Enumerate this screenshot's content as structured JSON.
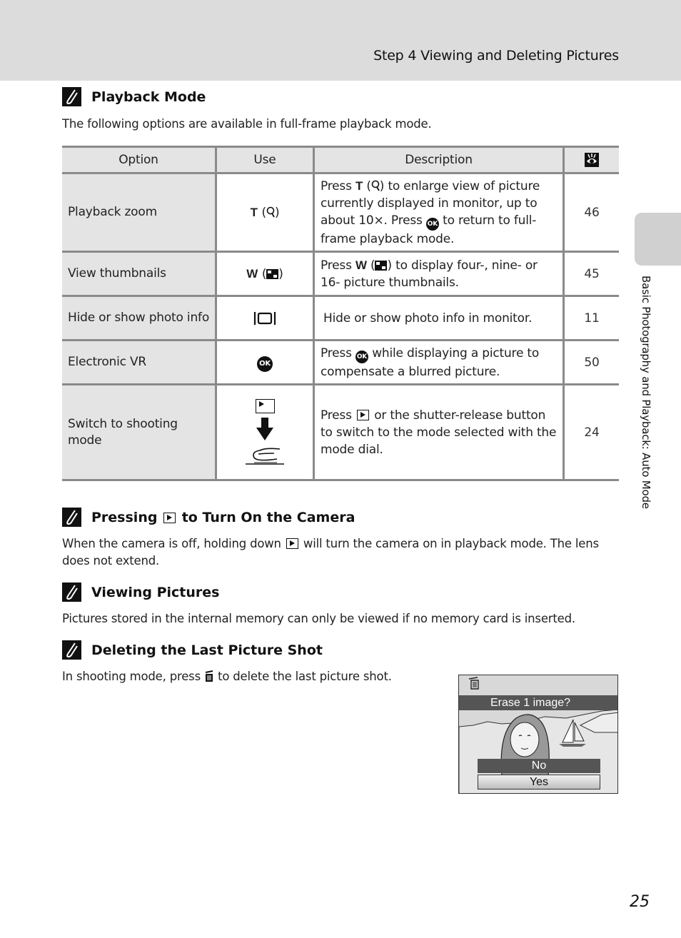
{
  "header": {
    "title": "Step 4 Viewing and Deleting Pictures"
  },
  "side_tab": {
    "label": "Basic Photography and Playback: Auto Mode"
  },
  "page_number": "25",
  "sections": {
    "playback_mode": {
      "title": "Playback Mode",
      "body": "The following options are available in full-frame playback mode."
    },
    "pressing_play": {
      "title_before": "Pressing",
      "title_after": "to Turn On the Camera",
      "body_before": "When the camera is off, holding down",
      "body_after": "will turn the camera on in playback mode. The lens does not extend."
    },
    "viewing_pictures": {
      "title": "Viewing Pictures",
      "body": "Pictures stored in the internal memory can only be viewed if no memory card is inserted."
    },
    "deleting_last": {
      "title": "Deleting the Last Picture Shot",
      "body_before": "In shooting mode, press",
      "body_after": "to delete the last picture shot."
    }
  },
  "table": {
    "headers": {
      "option": "Option",
      "use": "Use",
      "description": "Description",
      "page_icon": "reference-eye-icon"
    },
    "rows": [
      {
        "option": "Playback zoom",
        "use_key": "T",
        "use_icon": "magnifier-icon",
        "desc_1": "Press",
        "desc_key": "T",
        "desc_2": "to enlarge view of picture currently displayed in monitor, up to about 10×. Press",
        "desc_3": "to return to full-frame playback mode.",
        "page": "46"
      },
      {
        "option": "View thumbnails",
        "use_key": "W",
        "use_icon": "thumbnail-grid-icon",
        "desc_1": "Press",
        "desc_key": "W",
        "desc_2": "to display four-, nine- or 16- picture thumbnails.",
        "page": "45"
      },
      {
        "option": "Hide or show photo info",
        "use_icon": "display-button-icon",
        "desc_1": "Hide or show photo info in monitor.",
        "page": "11"
      },
      {
        "option": "Electronic VR",
        "use_icon": "ok-button-icon",
        "ok_label": "OK",
        "desc_1": "Press",
        "desc_2": "while displaying a picture to compensate a blurred picture.",
        "page": "50"
      },
      {
        "option": "Switch to shooting mode",
        "use_icon": "play-button-icon",
        "desc_1": "Press",
        "desc_2": "or the shutter-release button to switch to the mode selected with the mode dial.",
        "page": "24"
      }
    ]
  },
  "ok_label": "OK",
  "camera_screen": {
    "prompt": "Erase 1 image?",
    "options": [
      "No",
      "Yes"
    ],
    "selected": "Yes"
  }
}
